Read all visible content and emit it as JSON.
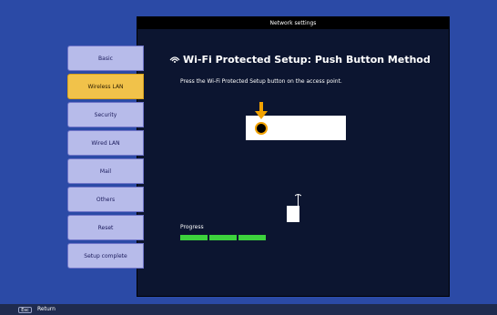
{
  "window": {
    "title": "Network settings"
  },
  "sidebar": {
    "items": [
      {
        "label": "Basic",
        "active": false
      },
      {
        "label": "Wireless LAN",
        "active": true
      },
      {
        "label": "Security",
        "active": false
      },
      {
        "label": "Wired LAN",
        "active": false
      },
      {
        "label": "Mail",
        "active": false
      },
      {
        "label": "Others",
        "active": false
      },
      {
        "label": "Reset",
        "active": false
      },
      {
        "label": "Setup complete",
        "active": false
      }
    ]
  },
  "main": {
    "heading": "Wi-Fi Protected Setup: Push Button Method",
    "instruction": "Press the Wi-Fi Protected Setup button on the access point.",
    "progress_label": "Progress",
    "progress_segments_total": 3,
    "progress_segments_filled": 3
  },
  "footer": {
    "esc_label": "Esc",
    "return_label": "Return"
  },
  "colors": {
    "active": "#f1c24a",
    "inactive": "#b7bbea",
    "progress": "#3dd23d",
    "arrow": "#f2a200"
  },
  "icons": [
    "wifi-icon",
    "down-arrow-icon",
    "push-button-icon",
    "access-point-icon"
  ]
}
